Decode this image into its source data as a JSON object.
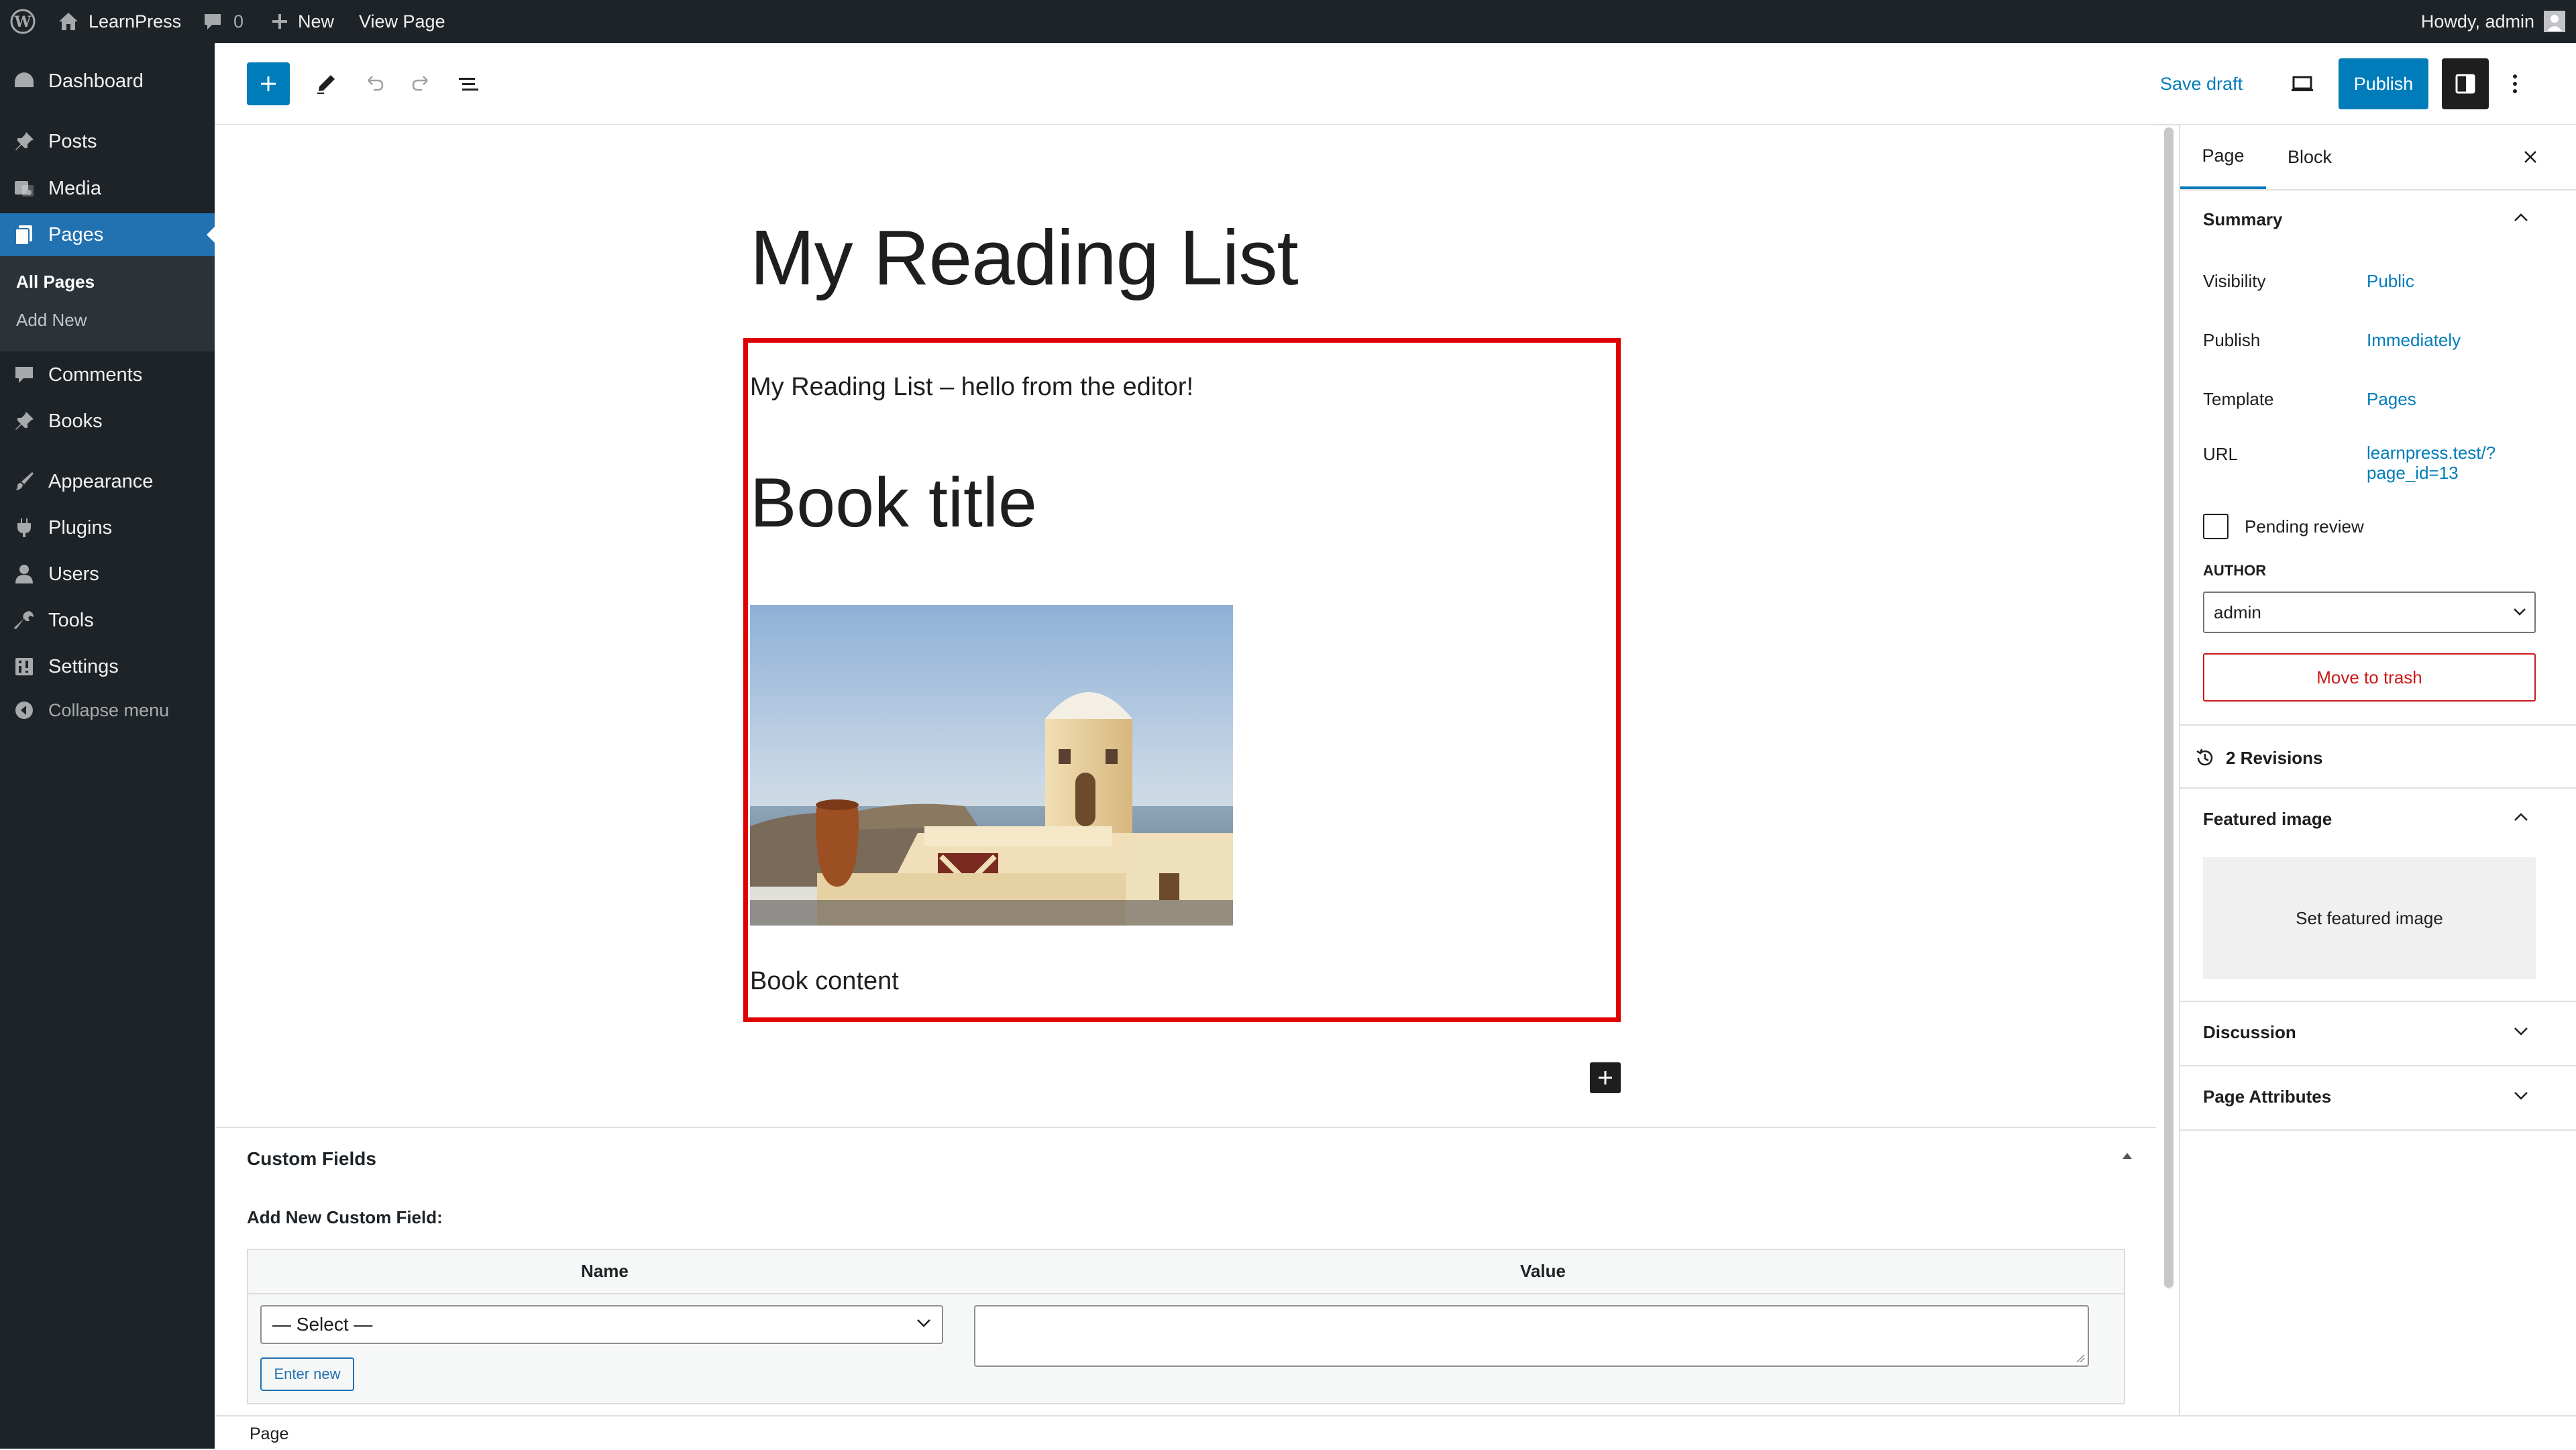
{
  "admin_bar": {
    "site_name": "LearnPress",
    "comments_count": "0",
    "new_label": "New",
    "view_page_label": "View Page",
    "howdy": "Howdy, admin"
  },
  "admin_menu": {
    "items": [
      {
        "label": "Dashboard",
        "icon": "dashboard-icon"
      },
      {
        "label": "Posts",
        "icon": "pin-icon"
      },
      {
        "label": "Media",
        "icon": "media-icon"
      },
      {
        "label": "Pages",
        "icon": "pages-icon",
        "current": true
      },
      {
        "label": "Comments",
        "icon": "comment-icon"
      },
      {
        "label": "Books",
        "icon": "pin-icon"
      },
      {
        "label": "Appearance",
        "icon": "brush-icon"
      },
      {
        "label": "Plugins",
        "icon": "plugin-icon"
      },
      {
        "label": "Users",
        "icon": "user-icon"
      },
      {
        "label": "Tools",
        "icon": "wrench-icon"
      },
      {
        "label": "Settings",
        "icon": "settings-icon"
      }
    ],
    "submenu": [
      "All Pages",
      "Add New"
    ],
    "collapse_label": "Collapse menu"
  },
  "editor_header": {
    "save_draft": "Save draft",
    "publish": "Publish"
  },
  "document": {
    "title": "My Reading List",
    "paragraph": "My Reading List – hello from the editor!",
    "heading": "Book title",
    "image_alt": "whitewashed building overlooking the sea",
    "content": "Book content"
  },
  "sidebar": {
    "tabs": [
      "Page",
      "Block"
    ],
    "summary_title": "Summary",
    "fields": {
      "visibility_label": "Visibility",
      "visibility_value": "Public",
      "publish_label": "Publish",
      "publish_value": "Immediately",
      "template_label": "Template",
      "template_value": "Pages",
      "url_label": "URL",
      "url_value_1": "learnpress.test/?",
      "url_value_2": "page_id=13"
    },
    "pending_review": "Pending review",
    "author_label": "AUTHOR",
    "author_value": "admin",
    "move_to_trash": "Move to trash",
    "revisions": "2 Revisions",
    "featured_image_title": "Featured image",
    "set_featured_image": "Set featured image",
    "discussion": "Discussion",
    "page_attributes": "Page Attributes"
  },
  "custom_fields": {
    "title": "Custom Fields",
    "add_new": "Add New Custom Field:",
    "name_header": "Name",
    "value_header": "Value",
    "select_value": "— Select —",
    "enter_new": "Enter new"
  },
  "footer": {
    "breadcrumb": "Page"
  },
  "colors": {
    "accent": "#007cba",
    "admin_dark": "#1d2327",
    "selection": "#e00000",
    "trash": "#cc1818"
  }
}
